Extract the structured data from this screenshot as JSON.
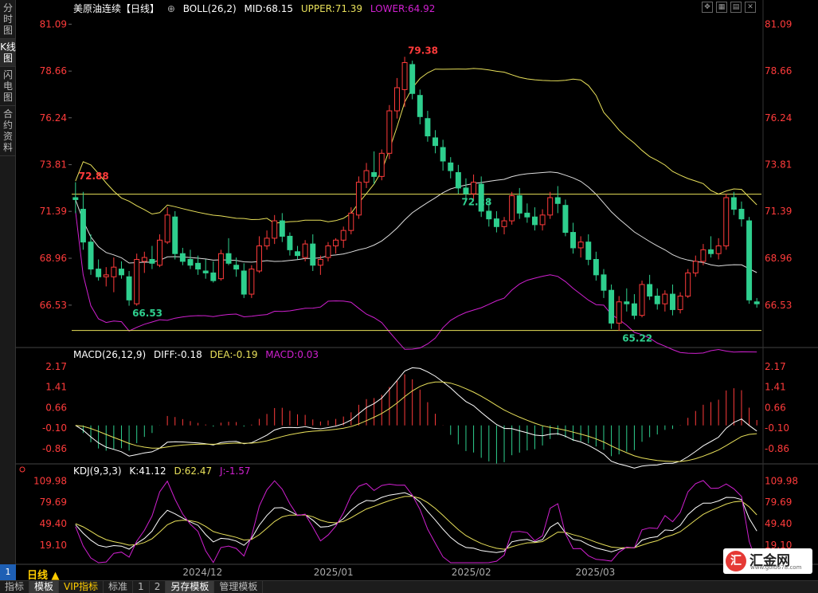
{
  "sidebar": {
    "tabs": [
      {
        "label": "分时图",
        "active": false
      },
      {
        "label": "K线图",
        "active": true
      },
      {
        "label": "闪电图",
        "active": false
      },
      {
        "label": "合约资料",
        "active": false
      }
    ],
    "page_number": "1"
  },
  "header": {
    "title": "美原油连续【日线】",
    "boll_label": "BOLL(26,2)",
    "mid": "MID:68.15",
    "upper": "UPPER:71.39",
    "lower": "LOWER:64.92"
  },
  "macd_header": {
    "label": "MACD(26,12,9)",
    "diff": "DIFF:-0.18",
    "dea": "DEA:-0.19",
    "macd": "MACD:0.03"
  },
  "kdj_header": {
    "label": "KDJ(9,3,3)",
    "k": "K:41.12",
    "d": "D:62.47",
    "j": "J:-1.57"
  },
  "period_label": "日线 ▲",
  "bottom_tabs": [
    {
      "label": "指标",
      "active": false
    },
    {
      "label": "模板",
      "active": true
    },
    {
      "label": "VIP指标",
      "active": false
    },
    {
      "label": "标准",
      "active": false
    },
    {
      "label": "1",
      "active": false
    },
    {
      "label": "2",
      "active": false
    },
    {
      "label": "另存模板",
      "active": true
    },
    {
      "label": "管理模板",
      "active": false
    }
  ],
  "logo": {
    "mark": "汇",
    "text": "汇金网",
    "url": "www.gold678.com"
  },
  "colors": {
    "up": "#ff3b3b",
    "down": "#2ecf8e",
    "mid": "#dddddd",
    "upper": "#e8e05a",
    "lower": "#d020d0",
    "axis_text": "#ff3b3b",
    "hline": "#e8e05a"
  },
  "chart_data": {
    "type": "candlestick",
    "x_labels": [
      "2024/12",
      "2025/01",
      "2025/02",
      "2025/03"
    ],
    "price_axis_ticks": [
      "81.09",
      "78.66",
      "76.24",
      "73.81",
      "71.39",
      "68.96",
      "66.53"
    ],
    "price_range": [
      64.5,
      81.6
    ],
    "annotations": [
      {
        "label": "72.88",
        "value": 72.88
      },
      {
        "label": "66.53",
        "value": 66.53
      },
      {
        "label": "79.38",
        "value": 79.38
      },
      {
        "label": "65.22",
        "value": 65.22
      },
      {
        "label": "72.28",
        "value": 72.28
      }
    ],
    "horizontal_lines": [
      72.28,
      65.22
    ],
    "candles": [
      [
        72.1,
        72.9,
        71.3,
        72.0
      ],
      [
        71.5,
        72.4,
        69.4,
        69.8
      ],
      [
        69.8,
        70.2,
        68.1,
        68.4
      ],
      [
        68.4,
        68.9,
        67.8,
        68.0
      ],
      [
        68.0,
        68.5,
        67.5,
        68.1
      ],
      [
        68.0,
        69.0,
        67.2,
        68.5
      ],
      [
        68.4,
        68.8,
        67.9,
        68.1
      ],
      [
        68.0,
        68.3,
        66.5,
        66.8
      ],
      [
        66.6,
        69.2,
        66.5,
        68.9
      ],
      [
        68.8,
        69.3,
        68.2,
        69.0
      ],
      [
        68.9,
        69.6,
        68.4,
        68.7
      ],
      [
        68.6,
        70.2,
        68.5,
        69.9
      ],
      [
        69.8,
        71.6,
        69.7,
        71.2
      ],
      [
        71.1,
        71.4,
        68.9,
        69.2
      ],
      [
        69.2,
        69.5,
        68.6,
        68.8
      ],
      [
        68.9,
        69.4,
        68.4,
        68.6
      ],
      [
        68.7,
        69.1,
        68.1,
        68.4
      ],
      [
        68.3,
        68.9,
        67.9,
        68.2
      ],
      [
        68.2,
        68.8,
        67.7,
        67.8
      ],
      [
        67.9,
        69.4,
        67.8,
        69.2
      ],
      [
        69.2,
        70.0,
        68.6,
        68.7
      ],
      [
        68.6,
        69.0,
        68.0,
        68.4
      ],
      [
        68.3,
        68.7,
        66.9,
        67.1
      ],
      [
        67.1,
        68.6,
        66.9,
        68.4
      ],
      [
        68.3,
        70.1,
        68.2,
        69.6
      ],
      [
        69.6,
        70.4,
        69.4,
        70.0
      ],
      [
        70.0,
        71.2,
        69.7,
        70.9
      ],
      [
        70.9,
        71.3,
        69.8,
        70.1
      ],
      [
        70.1,
        70.3,
        69.1,
        69.4
      ],
      [
        69.3,
        69.6,
        68.9,
        69.1
      ],
      [
        69.0,
        69.9,
        68.8,
        69.7
      ],
      [
        69.7,
        70.2,
        68.3,
        68.6
      ],
      [
        68.6,
        69.1,
        68.1,
        68.9
      ],
      [
        69.0,
        69.8,
        68.8,
        69.6
      ],
      [
        69.6,
        70.0,
        69.2,
        69.9
      ],
      [
        69.9,
        70.6,
        69.5,
        70.4
      ],
      [
        70.4,
        71.6,
        70.2,
        71.3
      ],
      [
        71.2,
        73.2,
        71.0,
        72.9
      ],
      [
        72.9,
        73.9,
        72.6,
        73.5
      ],
      [
        73.4,
        74.5,
        72.8,
        73.2
      ],
      [
        73.2,
        74.6,
        73.0,
        74.4
      ],
      [
        74.4,
        76.9,
        74.1,
        76.6
      ],
      [
        76.6,
        78.3,
        76.2,
        77.8
      ],
      [
        77.7,
        79.4,
        76.8,
        79.1
      ],
      [
        79.0,
        79.2,
        77.2,
        77.5
      ],
      [
        77.4,
        77.7,
        75.9,
        76.3
      ],
      [
        76.2,
        76.6,
        75.0,
        75.3
      ],
      [
        75.2,
        75.6,
        74.4,
        74.8
      ],
      [
        74.7,
        75.1,
        73.5,
        74.0
      ],
      [
        73.9,
        74.2,
        73.1,
        73.5
      ],
      [
        73.4,
        73.8,
        72.3,
        72.6
      ],
      [
        72.6,
        73.1,
        72.0,
        72.3
      ],
      [
        72.3,
        73.3,
        72.0,
        72.9
      ],
      [
        72.8,
        73.2,
        71.1,
        71.4
      ],
      [
        71.4,
        72.0,
        70.6,
        71.0
      ],
      [
        71.0,
        71.4,
        70.3,
        70.6
      ],
      [
        70.6,
        71.1,
        70.2,
        70.9
      ],
      [
        70.9,
        72.4,
        70.7,
        72.2
      ],
      [
        72.2,
        72.6,
        71.0,
        71.3
      ],
      [
        71.3,
        71.8,
        70.8,
        71.1
      ],
      [
        71.1,
        71.6,
        70.4,
        70.7
      ],
      [
        70.7,
        71.5,
        70.4,
        71.2
      ],
      [
        71.2,
        72.4,
        71.0,
        72.1
      ],
      [
        72.1,
        72.7,
        71.3,
        71.8
      ],
      [
        71.7,
        72.0,
        70.1,
        70.3
      ],
      [
        70.3,
        70.8,
        69.2,
        69.5
      ],
      [
        69.5,
        70.1,
        69.0,
        69.8
      ],
      [
        69.8,
        70.2,
        68.6,
        68.9
      ],
      [
        68.9,
        69.3,
        67.8,
        68.1
      ],
      [
        68.1,
        68.4,
        66.9,
        67.3
      ],
      [
        67.3,
        67.6,
        65.3,
        65.6
      ],
      [
        65.6,
        67.0,
        65.2,
        66.7
      ],
      [
        66.7,
        67.4,
        66.2,
        66.6
      ],
      [
        66.6,
        67.1,
        65.8,
        66.0
      ],
      [
        66.0,
        67.8,
        65.9,
        67.6
      ],
      [
        67.6,
        68.1,
        66.8,
        67.0
      ],
      [
        67.0,
        67.4,
        66.3,
        66.6
      ],
      [
        66.6,
        67.3,
        66.2,
        67.1
      ],
      [
        67.1,
        67.6,
        66.0,
        66.3
      ],
      [
        66.3,
        67.2,
        66.1,
        67.0
      ],
      [
        67.0,
        68.4,
        66.9,
        68.2
      ],
      [
        68.2,
        69.1,
        68.0,
        68.8
      ],
      [
        68.8,
        69.7,
        68.6,
        69.4
      ],
      [
        69.4,
        70.1,
        69.0,
        69.2
      ],
      [
        69.2,
        70.0,
        68.9,
        69.6
      ],
      [
        69.6,
        72.3,
        69.4,
        72.1
      ],
      [
        72.1,
        72.4,
        71.2,
        71.5
      ],
      [
        71.5,
        71.9,
        70.6,
        71.0
      ],
      [
        70.9,
        71.1,
        66.6,
        66.8
      ],
      [
        66.7,
        66.9,
        66.4,
        66.6
      ]
    ],
    "macd_axis_ticks": [
      "2.17",
      "1.41",
      "0.66",
      "-0.10",
      "-0.86"
    ],
    "macd_range": [
      -1.3,
      2.4
    ],
    "kdj_axis_ticks": [
      "109.98",
      "79.69",
      "49.40",
      "19.10"
    ],
    "kdj_range": [
      -6,
      116
    ]
  }
}
